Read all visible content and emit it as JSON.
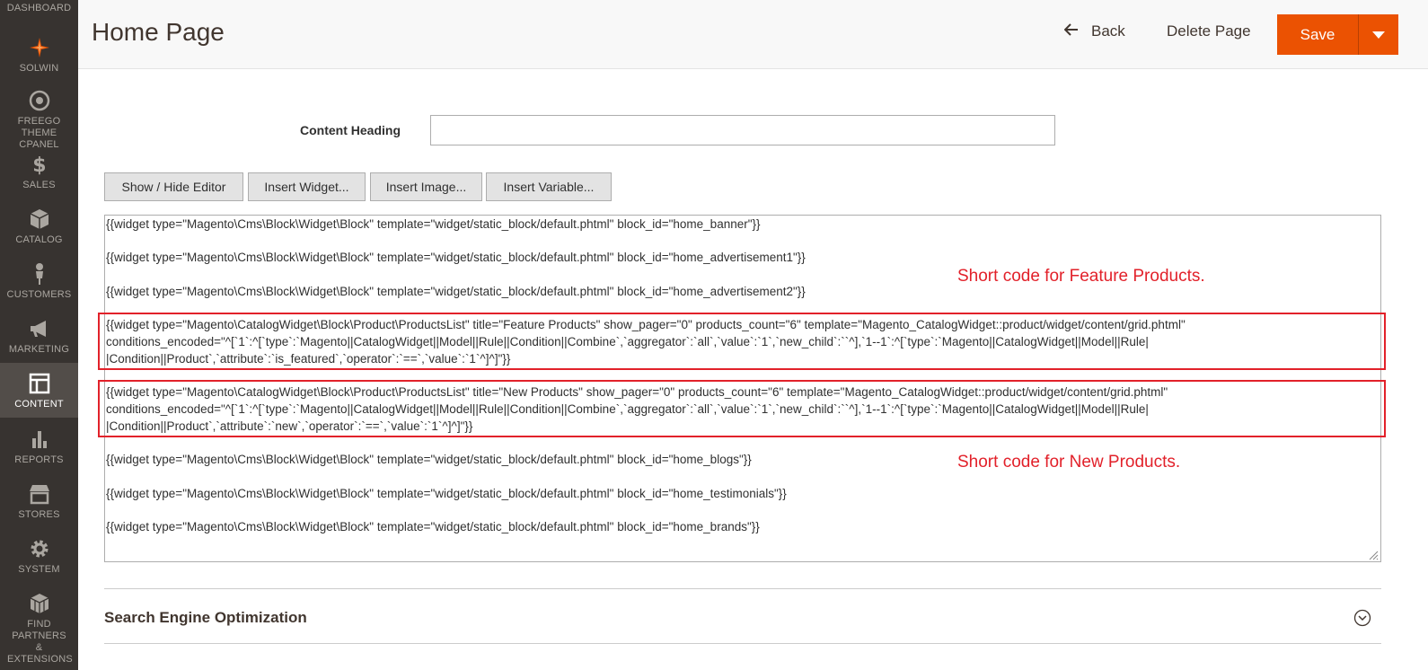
{
  "sidebar": {
    "items": [
      {
        "label": "DASHBOARD",
        "icon": "dashboard-icon"
      },
      {
        "label": "SOLWIN",
        "icon": "solwin-logo-icon"
      },
      {
        "label": "FREEGO THEME CPANEL",
        "icon": "target-icon"
      },
      {
        "label": "SALES",
        "icon": "dollar-icon"
      },
      {
        "label": "CATALOG",
        "icon": "box-icon"
      },
      {
        "label": "CUSTOMERS",
        "icon": "person-icon"
      },
      {
        "label": "MARKETING",
        "icon": "megaphone-icon"
      },
      {
        "label": "CONTENT",
        "icon": "layout-icon"
      },
      {
        "label": "REPORTS",
        "icon": "bar-chart-icon"
      },
      {
        "label": "STORES",
        "icon": "store-icon"
      },
      {
        "label": "SYSTEM",
        "icon": "gear-icon"
      },
      {
        "label": "FIND PARTNERS & EXTENSIONS",
        "icon": "cubes-icon"
      }
    ],
    "active": "CONTENT"
  },
  "header": {
    "title": "Home Page",
    "back_label": "Back",
    "delete_label": "Delete Page",
    "save_label": "Save"
  },
  "form": {
    "content_heading_label": "Content Heading",
    "content_heading_value": ""
  },
  "editor": {
    "buttons": {
      "show_hide": "Show / Hide Editor",
      "insert_widget": "Insert Widget...",
      "insert_image": "Insert Image...",
      "insert_variable": "Insert Variable..."
    },
    "lines": {
      "banner": "{{widget type=\"Magento\\Cms\\Block\\Widget\\Block\" template=\"widget/static_block/default.phtml\" block_id=\"home_banner\"}}",
      "adv1": "{{widget type=\"Magento\\Cms\\Block\\Widget\\Block\" template=\"widget/static_block/default.phtml\" block_id=\"home_advertisement1\"}}",
      "adv2": "{{widget type=\"Magento\\Cms\\Block\\Widget\\Block\" template=\"widget/static_block/default.phtml\" block_id=\"home_advertisement2\"}}",
      "feature_1": "{{widget type=\"Magento\\CatalogWidget\\Block\\Product\\ProductsList\" title=\"Feature Products\" show_pager=\"0\" products_count=\"6\" template=\"Magento_CatalogWidget::product/widget/content/grid.phtml\"",
      "feature_2": "conditions_encoded=\"^[`1`:^[`type`:`Magento||CatalogWidget||Model||Rule||Condition||Combine`,`aggregator`:`all`,`value`:`1`,`new_child`:``^],`1--1`:^[`type`:`Magento||CatalogWidget||Model||Rule|",
      "feature_3": "|Condition||Product`,`attribute`:`is_featured`,`operator`:`==`,`value`:`1`^]^]\"}}",
      "new_1": "{{widget type=\"Magento\\CatalogWidget\\Block\\Product\\ProductsList\" title=\"New Products\" show_pager=\"0\" products_count=\"6\" template=\"Magento_CatalogWidget::product/widget/content/grid.phtml\"",
      "new_2": "conditions_encoded=\"^[`1`:^[`type`:`Magento||CatalogWidget||Model||Rule||Condition||Combine`,`aggregator`:`all`,`value`:`1`,`new_child`:``^],`1--1`:^[`type`:`Magento||CatalogWidget||Model||Rule|",
      "new_3": "|Condition||Product`,`attribute`:`new`,`operator`:`==`,`value`:`1`^]^]\"}}",
      "blogs": "{{widget type=\"Magento\\Cms\\Block\\Widget\\Block\" template=\"widget/static_block/default.phtml\" block_id=\"home_blogs\"}}",
      "testimonials": "{{widget type=\"Magento\\Cms\\Block\\Widget\\Block\" template=\"widget/static_block/default.phtml\" block_id=\"home_testimonials\"}}",
      "brands": "{{widget type=\"Magento\\Cms\\Block\\Widget\\Block\" template=\"widget/static_block/default.phtml\" block_id=\"home_brands\"}}"
    }
  },
  "annotations": {
    "feature": "Short code for Feature Products.",
    "new": "Short code for New Products."
  },
  "seo": {
    "title": "Search Engine Optimization"
  },
  "colors": {
    "accent": "#eb5202",
    "sidebar_bg": "#373330",
    "highlight": "#e2212a"
  }
}
